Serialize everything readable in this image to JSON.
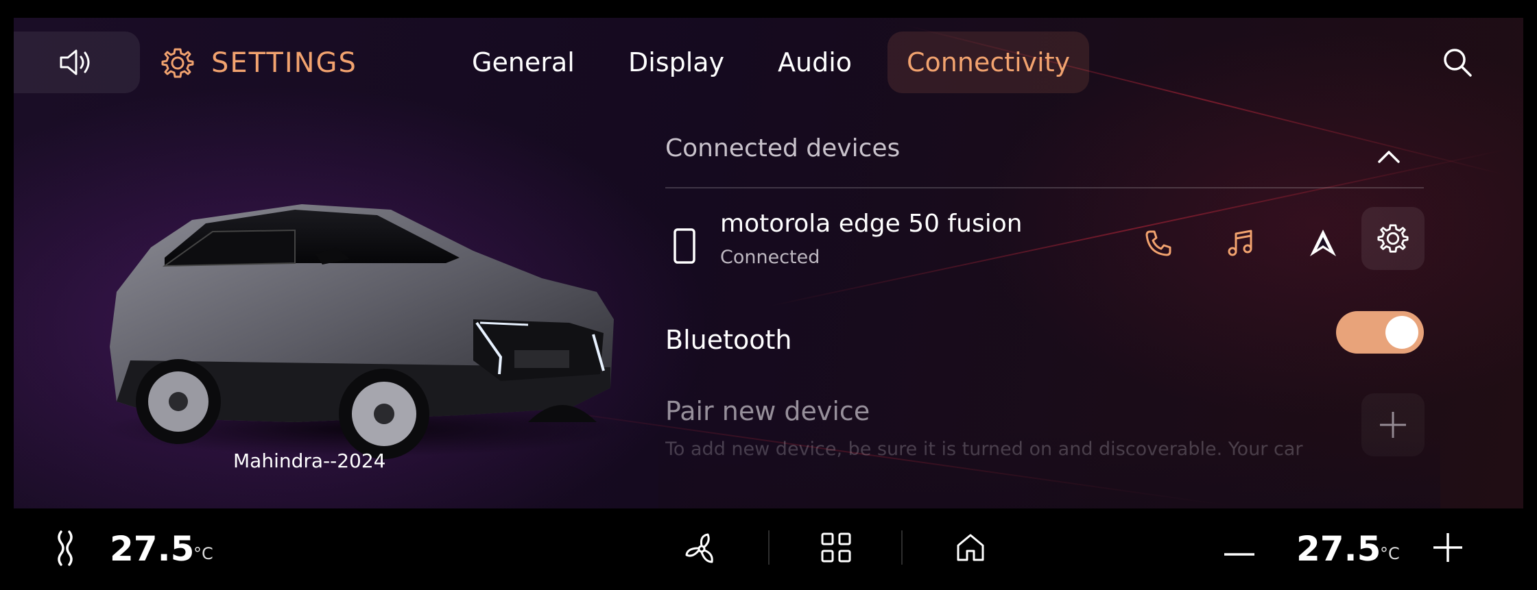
{
  "header": {
    "volume_icon": "volume-icon",
    "settings_icon": "gear-icon",
    "title": "SETTINGS",
    "tabs": [
      {
        "label": "General",
        "active": false
      },
      {
        "label": "Display",
        "active": false
      },
      {
        "label": "Audio",
        "active": false
      },
      {
        "label": "Connectivity",
        "active": true
      }
    ],
    "search_icon": "search-icon"
  },
  "vehicle": {
    "label": "Mahindra--2024"
  },
  "connectivity": {
    "section_title": "Connected devices",
    "collapse_icon": "chevron-up-icon",
    "device": {
      "name": "motorola edge 50 fusion",
      "status": "Connected",
      "icon": "phone-icon",
      "actions": [
        "call-icon",
        "music-icon",
        "android-auto-icon",
        "gear-icon"
      ]
    },
    "bluetooth": {
      "label": "Bluetooth",
      "enabled": true
    },
    "pair": {
      "label": "Pair new device",
      "description": "To add new device, be sure it is turned on and discoverable. Your car",
      "icon": "plus-icon"
    }
  },
  "climate": {
    "left_temp": "27.5",
    "left_unit": "°C",
    "right_temp": "27.5",
    "right_unit": "°C",
    "minus_icon": "minus-icon",
    "plus_icon": "plus-icon"
  },
  "dock": {
    "items": [
      "seat-heat-icon",
      "fan-icon",
      "apps-grid-icon",
      "home-icon"
    ]
  },
  "colors": {
    "accent": "#f2a36f",
    "toggle_on": "#e8a37a",
    "background": "#150a1f"
  }
}
